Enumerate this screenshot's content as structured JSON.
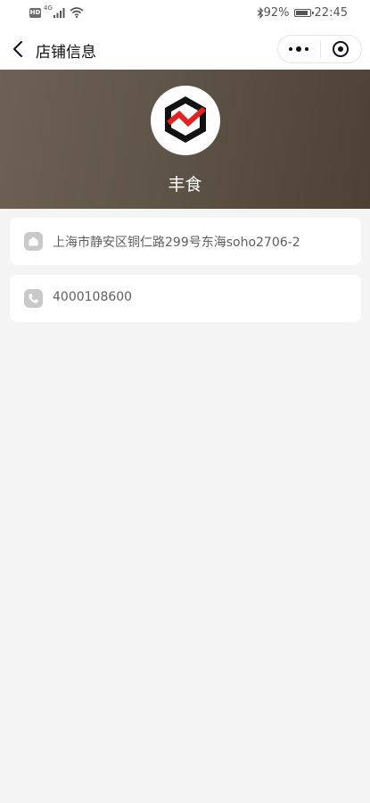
{
  "status_bar": {
    "hd_label": "HD",
    "network_type": "4G",
    "battery_percent": "92%",
    "battery_level": 0.92,
    "time": "22:45"
  },
  "nav": {
    "title": "店铺信息"
  },
  "shop": {
    "name": "丰食",
    "address": "上海市静安区铜仁路299号东海soho2706-2",
    "phone": "4000108600"
  },
  "colors": {
    "banner_start": "#6d6155",
    "banner_end": "#4d4034",
    "logo_black": "#111111",
    "logo_red": "#e32222",
    "card_icon_bg": "#c9c9c9",
    "page_bg": "#f4f4f4"
  },
  "icons": {
    "back": "chevron-left-icon",
    "more": "more-dots-icon",
    "close": "target-ring-icon",
    "address": "home-icon",
    "phone": "phone-icon",
    "bluetooth": "bluetooth-icon",
    "wifi": "wifi-icon",
    "signal": "signal-bars-icon",
    "battery": "battery-icon"
  }
}
